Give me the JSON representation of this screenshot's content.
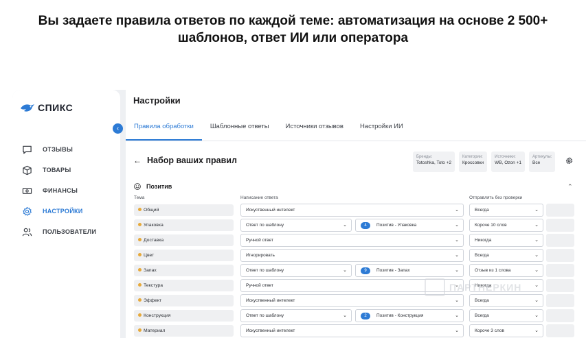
{
  "headline": {
    "line1": "Вы задаете правила ответов по каждой теме: автоматизация на основе 2 500+",
    "line2": "шаблонов, ответ ИИ или оператора"
  },
  "brand": {
    "name": "СПИКС",
    "color": "#2d7bd5"
  },
  "sidebar": {
    "collapse_icon": "chevron-left-icon",
    "items": [
      {
        "label": "ОТЗЫВЫ",
        "icon": "chat-icon",
        "active": false
      },
      {
        "label": "ТОВАРЫ",
        "icon": "box-icon",
        "active": false
      },
      {
        "label": "ФИНАНСЫ",
        "icon": "banknote-icon",
        "active": false
      },
      {
        "label": "НАСТРОЙКИ",
        "icon": "gear-icon",
        "active": true
      },
      {
        "label": "ПОЛЬЗОВАТЕЛИ",
        "icon": "users-icon",
        "active": false
      }
    ]
  },
  "main": {
    "title": "Настройки",
    "tabs": [
      {
        "label": "Правила обработки",
        "active": true
      },
      {
        "label": "Шаблонные ответы",
        "active": false
      },
      {
        "label": "Источники отзывов",
        "active": false
      },
      {
        "label": "Настройки ИИ",
        "active": false
      }
    ],
    "rules_title": "Набор ваших правил",
    "filters": [
      {
        "label": "Бренды:",
        "value": "Totoshka, Toto +2"
      },
      {
        "label": "Категории:",
        "value": "Кроссовки"
      },
      {
        "label": "Источники:",
        "value": "WB, Ozon +1"
      },
      {
        "label": "Артикулы:",
        "value": "Все"
      }
    ],
    "section": {
      "title": "Позитив",
      "columns": {
        "theme": "Тема",
        "response": "Написание ответа",
        "send": "Отправлять без проверки"
      },
      "rows": [
        {
          "theme": "Общий",
          "response": "Искуственный интелект",
          "count": "",
          "template": "",
          "send": "Всегда"
        },
        {
          "theme": "Упаковка",
          "response": "Ответ по шаблону",
          "count": "4",
          "template": "Позитив - Упаковка",
          "send": "Короче 10 слов"
        },
        {
          "theme": "Доставка",
          "response": "Ручной ответ",
          "count": "",
          "template": "",
          "send": "Никогда"
        },
        {
          "theme": "Цвет",
          "response": "Игнорировать",
          "count": "",
          "template": "",
          "send": "Всегда"
        },
        {
          "theme": "Запах",
          "response": "Ответ по шаблону",
          "count": "9",
          "template": "Позитив - Запах",
          "send": "Отзыв из 1 слова"
        },
        {
          "theme": "Текстура",
          "response": "Ручной ответ",
          "count": "",
          "template": "",
          "send": "Никогда"
        },
        {
          "theme": "Эффект",
          "response": "Искуственный интелект",
          "count": "",
          "template": "",
          "send": "Всегда"
        },
        {
          "theme": "Конструкция",
          "response": "Ответ по шаблону",
          "count": "2",
          "template": "Позитив - Конструкция",
          "send": "Всегда"
        },
        {
          "theme": "Материал",
          "response": "Искуственный интелект",
          "count": "",
          "template": "",
          "send": "Короче 3 слов"
        }
      ]
    }
  },
  "watermark": {
    "text": "ПАРТНЕРКИН"
  }
}
